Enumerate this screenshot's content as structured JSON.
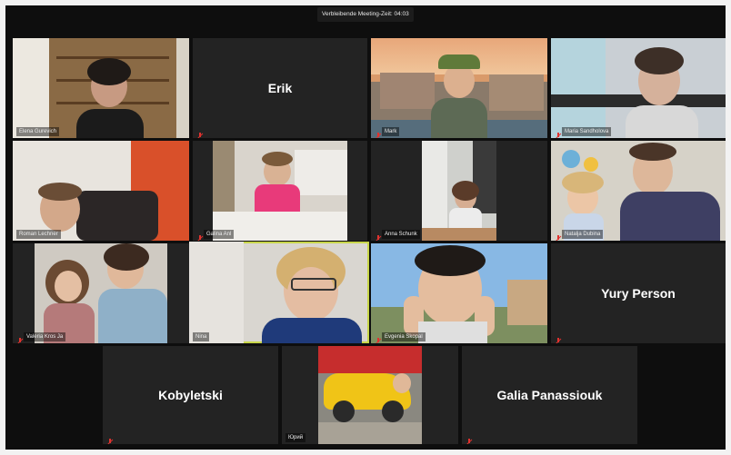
{
  "meeting": {
    "timer_text": "Verbleibende Meeting-Zeit: 04:03"
  },
  "participants": [
    {
      "name": "Elena Gurevich",
      "video": true
    },
    {
      "name": "Erik",
      "video": false
    },
    {
      "name": "Mark",
      "video": true
    },
    {
      "name": "Maria Sandholova",
      "video": true
    },
    {
      "name": "Roman Lechner",
      "video": true
    },
    {
      "name": "Galina Anl",
      "video": true
    },
    {
      "name": "Anna Schunk",
      "video": true
    },
    {
      "name": "Natalja Dubina",
      "video": true
    },
    {
      "name": "Valeria Kros Ja",
      "video": true
    },
    {
      "name": "Nina",
      "video": true,
      "active_speaker": true
    },
    {
      "name": "Evgenia Skopal",
      "video": true
    },
    {
      "name": "Yury Person",
      "video": false
    },
    {
      "name": "Kobyletski",
      "video": false
    },
    {
      "name": "Юрий",
      "video": true
    },
    {
      "name": "Galia Panassiouk",
      "video": false
    }
  ],
  "colors": {
    "active_border": "#c8d64a",
    "mic_muted": "#e0322f",
    "background": "#0e0e0e"
  }
}
